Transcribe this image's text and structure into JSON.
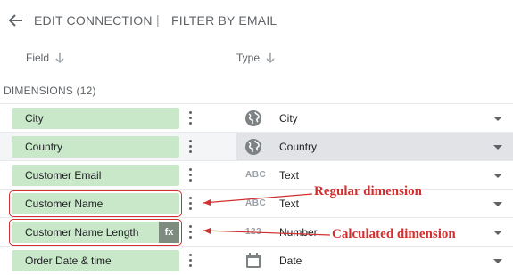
{
  "topbar": {
    "back_icon": "arrow-left-icon",
    "edit_connection": "EDIT CONNECTION",
    "separator": "|",
    "filter_by_email": "FILTER BY EMAIL"
  },
  "columns": {
    "field": "Field",
    "type": "Type",
    "sort_icon": "arrow-down-icon"
  },
  "dimensions_label": "DIMENSIONS (12)",
  "rows": [
    {
      "field": "City",
      "type": "City",
      "type_icon": "globe-icon"
    },
    {
      "field": "Country",
      "type": "Country",
      "type_icon": "globe-icon"
    },
    {
      "field": "Customer Email",
      "type": "Text",
      "type_icon": "abc-text-icon",
      "type_icon_text": "ABC"
    },
    {
      "field": "Customer Name",
      "type": "Text",
      "type_icon": "abc-text-icon",
      "type_icon_text": "ABC"
    },
    {
      "field": "Customer Name Length",
      "type": "Number",
      "type_icon": "number-123-icon",
      "type_icon_text": "123",
      "calc_badge": "fx"
    },
    {
      "field": "Order Date & time",
      "type": "Date",
      "type_icon": "calendar-icon"
    }
  ],
  "annotations": {
    "regular": "Regular dimension",
    "calculated": "Calculated dimension"
  },
  "colors": {
    "chip_bg": "#c9e8ca",
    "annotation": "#d32f2f",
    "selected_row": "#f4f5f6",
    "selected_type": "#e1e3e6",
    "fx_badge": "#7d8c7e"
  }
}
